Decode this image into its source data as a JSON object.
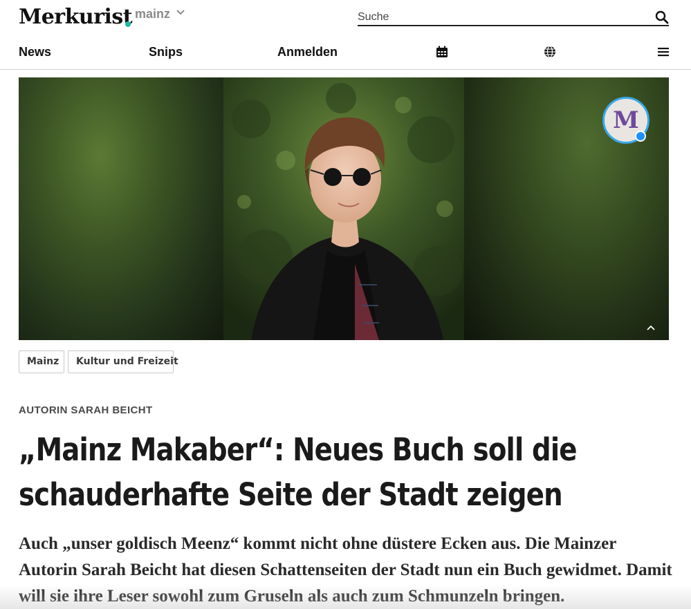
{
  "header": {
    "logo": "Merkurist",
    "city": "mainz",
    "search": {
      "placeholder": "Suche"
    }
  },
  "nav": {
    "items": [
      "News",
      "Snips",
      "Anmelden"
    ],
    "icons": [
      "calendar-icon",
      "globe-icon",
      "menu-icon"
    ]
  },
  "hero": {
    "badge_letter": "M"
  },
  "tags": [
    "Mainz",
    "Kultur und Freizeit"
  ],
  "article": {
    "kicker": "AUTORIN SARAH BEICHT",
    "headline": "„Mainz Makaber“: Neues Buch soll die schauderhafte Seite der Stadt zeigen",
    "lead": "Auch „unser goldisch Meenz“ kommt nicht ohne düstere Ecken aus. Die Mainzer Autorin Sarah Beicht hat diesen Schattenseiten der Stadt nun ein Buch gewidmet. Damit will sie ihre Leser sowohl zum Gruseln als auch zum Schmunzeln bringen."
  },
  "colors": {
    "accent": "#1fb9a6",
    "badge_ring": "#3aa8e8",
    "text": "#1a1a1a"
  }
}
